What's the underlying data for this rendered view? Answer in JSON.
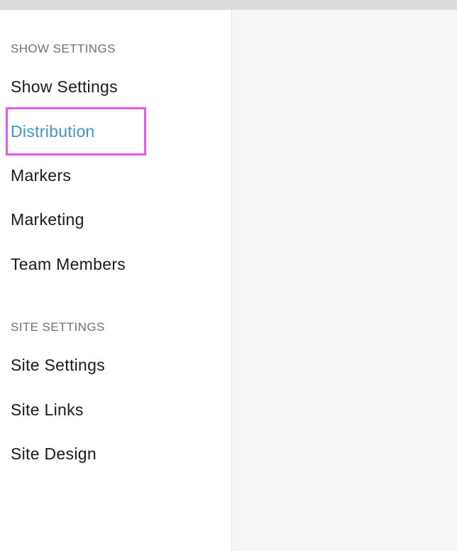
{
  "sidebar": {
    "show_settings_header": "SHOW SETTINGS",
    "show_items": [
      {
        "label": "Show Settings"
      },
      {
        "label": "Distribution"
      },
      {
        "label": "Markers"
      },
      {
        "label": "Marketing"
      },
      {
        "label": "Team Members"
      }
    ],
    "site_settings_header": "SITE SETTINGS",
    "site_items": [
      {
        "label": "Site Settings"
      },
      {
        "label": "Site Links"
      },
      {
        "label": "Site Design"
      }
    ],
    "active_item": "Distribution"
  },
  "colors": {
    "active": "#3e95c8",
    "highlight": "#e65be6",
    "text": "#1a1a1a",
    "header": "#6f6f6f"
  }
}
